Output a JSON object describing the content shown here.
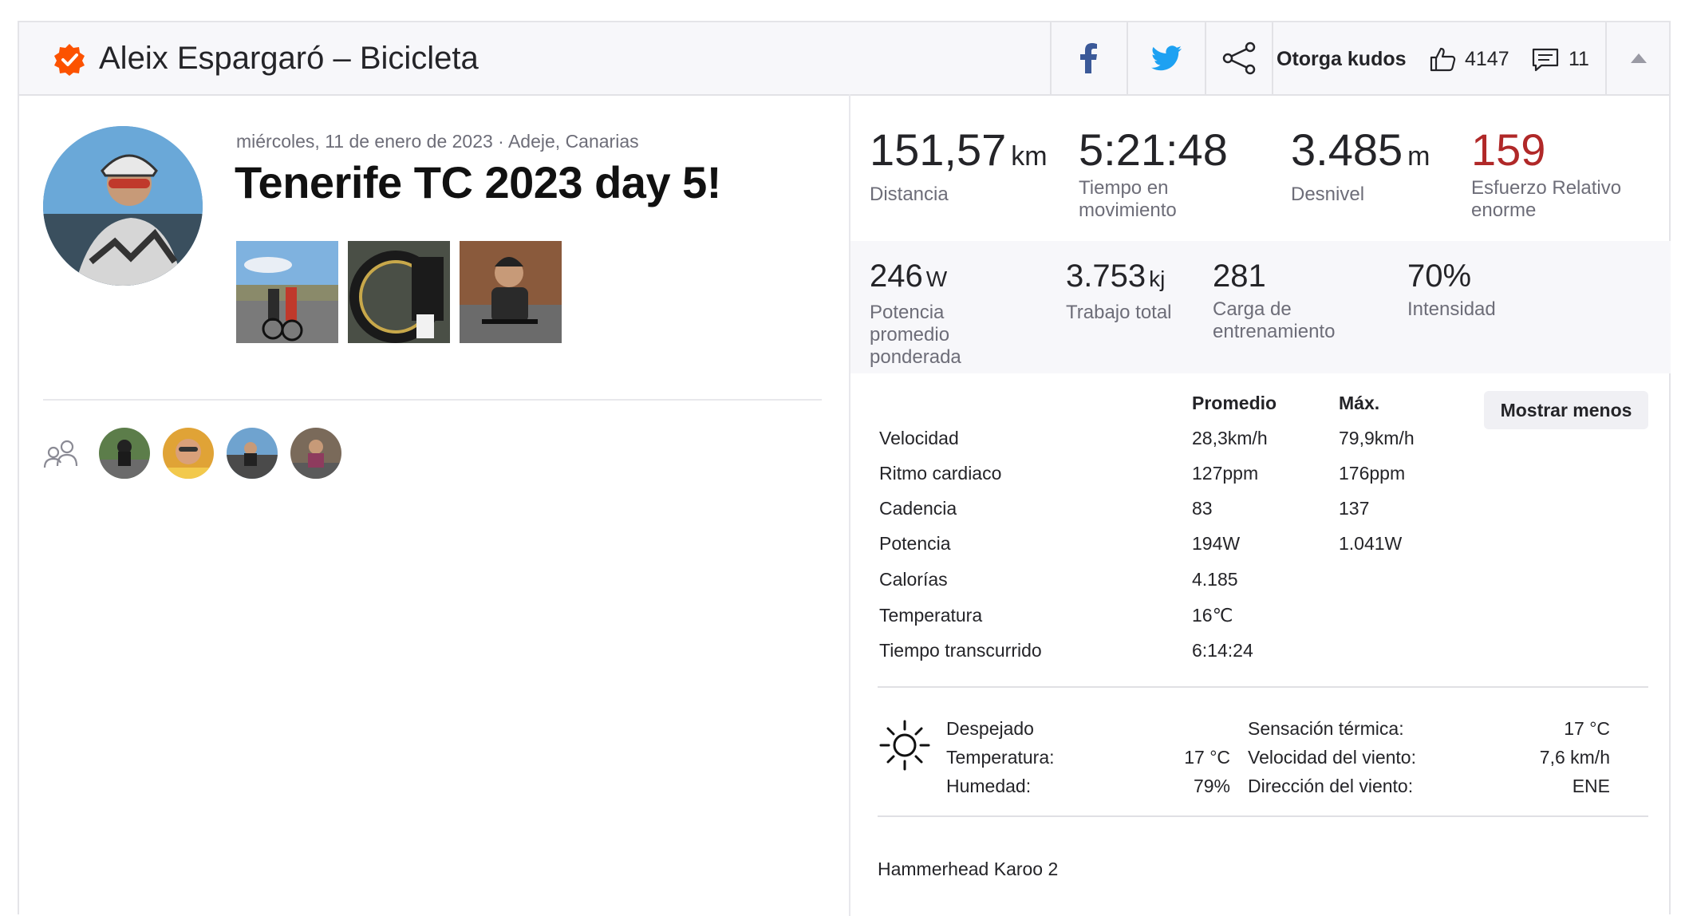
{
  "header": {
    "title": "Aleix Espargaró – Bicicleta",
    "kudos_label": "Otorga kudos",
    "kudos_count": "4147",
    "comment_count": "11",
    "icons": [
      "verified-badge-icon",
      "facebook-icon",
      "twitter-icon",
      "share-icon",
      "thumbs-up-icon",
      "comment-icon",
      "collapse-arrow-icon"
    ],
    "colors": {
      "badge": "#fc5200",
      "facebook": "#3b5998",
      "twitter": "#1da1f2"
    }
  },
  "activity": {
    "date_location": "miércoles, 11 de enero de 2023 · Adeje, Canarias",
    "title": "Tenerife TC 2023 day 5!"
  },
  "primary_stats": [
    {
      "value": "151,57",
      "unit": "km",
      "label": "Distancia"
    },
    {
      "value": "5:21:48",
      "unit": "",
      "label_lines": [
        "Tiempo en",
        "movimiento"
      ]
    },
    {
      "value": "3.485",
      "unit": "m",
      "label": "Desnivel"
    },
    {
      "value": "159",
      "unit": "",
      "label_lines": [
        "Esfuerzo Relativo",
        "enorme"
      ],
      "color": "#b02828"
    }
  ],
  "secondary_stats": [
    {
      "value": "246",
      "unit": "W",
      "label_lines": [
        "Potencia",
        "promedio",
        "ponderada"
      ]
    },
    {
      "value": "3.753",
      "unit": "kj",
      "label": "Trabajo total"
    },
    {
      "value": "281",
      "unit": "",
      "label_lines": [
        "Carga de",
        "entrenamiento"
      ]
    },
    {
      "value": "70%",
      "unit": "",
      "label": "Intensidad"
    }
  ],
  "table": {
    "col_avg": "Promedio",
    "col_max": "Máx.",
    "toggle_label": "Mostrar menos",
    "rows": [
      {
        "label": "Velocidad",
        "avg": "28,3km/h",
        "max": "79,9km/h"
      },
      {
        "label": "Ritmo cardiaco",
        "avg": "127ppm",
        "max": "176ppm"
      },
      {
        "label": "Cadencia",
        "avg": "83",
        "max": "137"
      },
      {
        "label": "Potencia",
        "avg": "194W",
        "max": "1.041W"
      },
      {
        "label": "Calorías",
        "avg": "4.185",
        "max": ""
      },
      {
        "label": "Temperatura",
        "avg": "16℃",
        "max": ""
      },
      {
        "label": "Tiempo transcurrido",
        "avg": "6:14:24",
        "max": ""
      }
    ]
  },
  "weather": {
    "condition": "Despejado",
    "temp_label": "Temperatura:",
    "temp_value": "17 °C",
    "humidity_label": "Humedad:",
    "humidity_value": "79%",
    "feels_label": "Sensación térmica:",
    "feels_value": "17 °C",
    "wind_speed_label": "Velocidad del viento:",
    "wind_speed_value": "7,6 km/h",
    "wind_dir_label": "Dirección del viento:",
    "wind_dir_value": "ENE",
    "icon": "sun-icon"
  },
  "device": "Hammerhead Karoo 2"
}
